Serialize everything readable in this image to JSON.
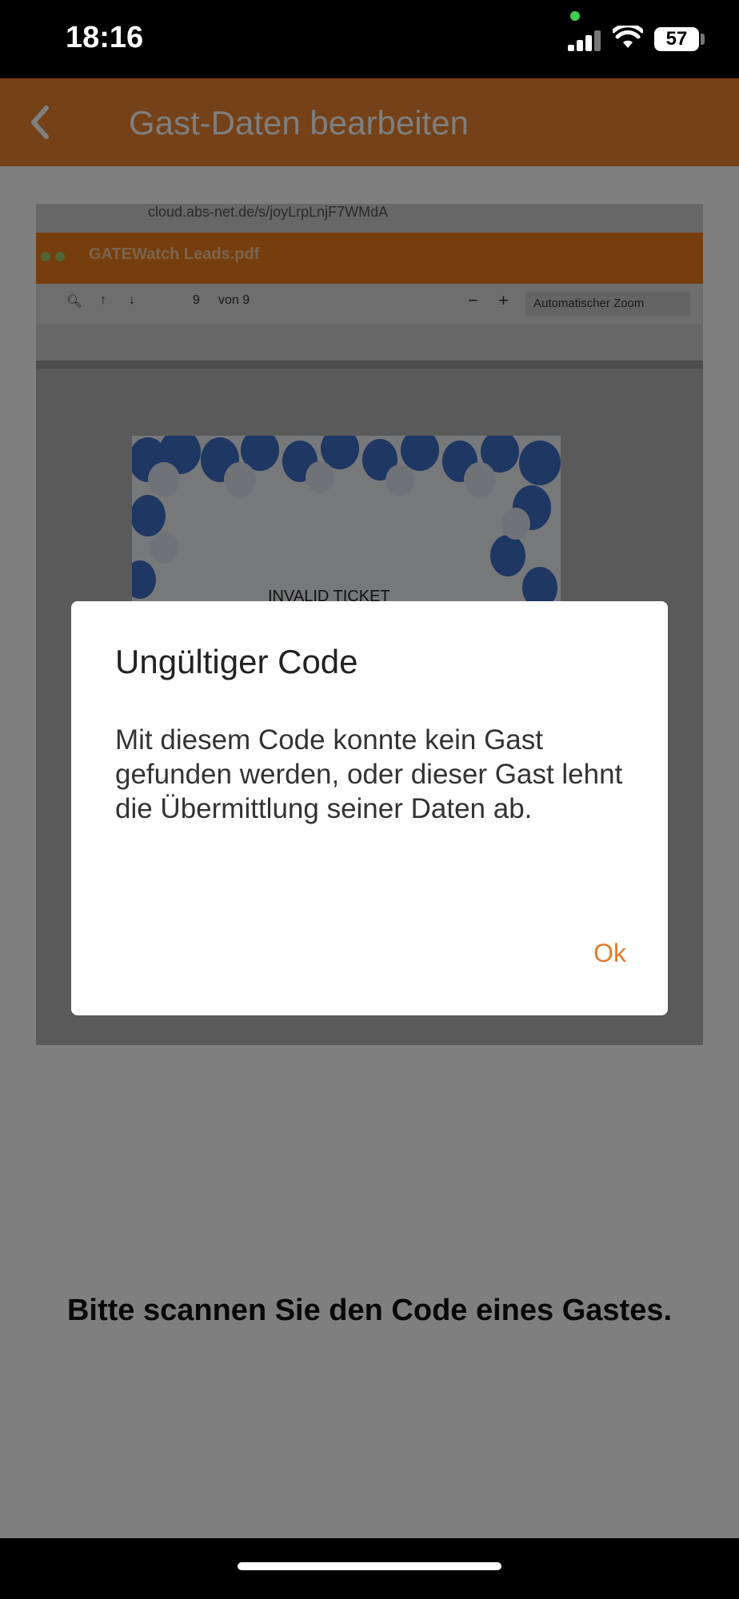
{
  "status_bar": {
    "time": "18:16",
    "battery": "57"
  },
  "app_bar": {
    "title": "Gast-Daten bearbeiten",
    "back_icon": "chevron-left-icon",
    "color": "#e98231"
  },
  "camera_view": {
    "url": "cloud.abs-net.de/s/joyLrpLnjF7WMdA",
    "pdf_title": "GATEWatch Leads.pdf",
    "page_number": "9",
    "page_total": "von 9",
    "zoom": "Automatischer Zoom",
    "ticket_text": "INVALID TICKET"
  },
  "scan_hint": "Bitte scannen Sie den Code eines Gastes.",
  "dialog": {
    "title": "Ungültiger Code",
    "body": "Mit diesem Code konnte kein Gast gefunden werden, oder dieser Gast lehnt die Übermittlung seiner Daten ab.",
    "ok_label": "Ok",
    "accent": "#e27b2b"
  }
}
